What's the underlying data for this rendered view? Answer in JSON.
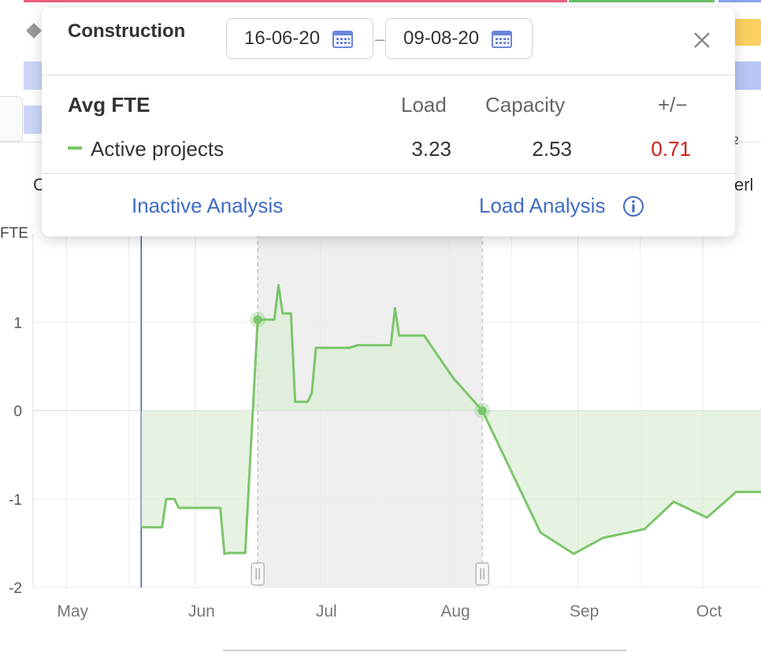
{
  "popup": {
    "title": "Construction",
    "start_date": "16-06-20",
    "end_date": "09-08-20",
    "date_separator": "–",
    "close_icon": "close-icon",
    "calendar_icon": "calendar-icon",
    "table": {
      "header_label": "Avg FTE",
      "col_load": "Load",
      "col_capacity": "Capacity",
      "col_diff": "+/−",
      "row_label": "Active projects",
      "row_color": "#7cc56b",
      "load": "3.23",
      "capacity": "2.53",
      "diff": "0.71",
      "diff_color": "#d01b1b"
    },
    "link_inactive": "Inactive Analysis",
    "link_load": "Load Analysis",
    "info_icon": "info-icon",
    "link_color": "#3f6cc4"
  },
  "background": {
    "left_fragment": "C",
    "right_fragment": "erl",
    "top_right_fragment": "2"
  },
  "chart_data": {
    "type": "area",
    "y_unit_label": "FTE",
    "ylim": [
      -2,
      2
    ],
    "yticks": [
      "1",
      "0",
      "-1",
      "-2"
    ],
    "x_tick_labels": [
      "May",
      "Jun",
      "Jul",
      "Aug",
      "Sep",
      "Oct"
    ],
    "x_range": [
      "2020-04-23",
      "2020-10-15"
    ],
    "x_tick_dates": [
      "2020-05-01",
      "2020-06-01",
      "2020-07-01",
      "2020-08-01",
      "2020-09-01",
      "2020-10-01"
    ],
    "today": "2020-05-19",
    "selection": [
      "2020-06-16",
      "2020-08-09"
    ],
    "series_color": "#7cc56b",
    "fill_color": "#d8ecd2",
    "grid": true,
    "series": [
      {
        "points": [
          [
            "2020-05-19",
            -1.32
          ],
          [
            "2020-05-24",
            -1.32
          ],
          [
            "2020-05-25",
            -1.0
          ],
          [
            "2020-05-27",
            -1.0
          ],
          [
            "2020-05-28",
            -1.1
          ],
          [
            "2020-06-07",
            -1.1
          ],
          [
            "2020-06-08",
            -1.62
          ],
          [
            "2020-06-09",
            -1.61
          ],
          [
            "2020-06-13",
            -1.61
          ],
          [
            "2020-06-16",
            1.03
          ],
          [
            "2020-06-20",
            1.03
          ],
          [
            "2020-06-21",
            1.42
          ],
          [
            "2020-06-22",
            1.1
          ],
          [
            "2020-06-24",
            1.1
          ],
          [
            "2020-06-25",
            0.1
          ],
          [
            "2020-06-28",
            0.1
          ],
          [
            "2020-06-29",
            0.2
          ],
          [
            "2020-06-30",
            0.71
          ],
          [
            "2020-07-08",
            0.71
          ],
          [
            "2020-07-10",
            0.74
          ],
          [
            "2020-07-18",
            0.74
          ],
          [
            "2020-07-19",
            1.16
          ],
          [
            "2020-07-20",
            0.85
          ],
          [
            "2020-07-26",
            0.85
          ],
          [
            "2020-08-02",
            0.37
          ],
          [
            "2020-08-09",
            0.0
          ],
          [
            "2020-08-23",
            -1.38
          ],
          [
            "2020-08-31",
            -1.62
          ],
          [
            "2020-09-07",
            -1.44
          ],
          [
            "2020-09-17",
            -1.34
          ],
          [
            "2020-09-24",
            -1.03
          ],
          [
            "2020-10-02",
            -1.21
          ],
          [
            "2020-10-09",
            -0.92
          ],
          [
            "2020-10-15",
            -0.92
          ]
        ]
      }
    ],
    "markers": [
      [
        "2020-06-16",
        1.03
      ],
      [
        "2020-08-09",
        0.0
      ]
    ]
  }
}
